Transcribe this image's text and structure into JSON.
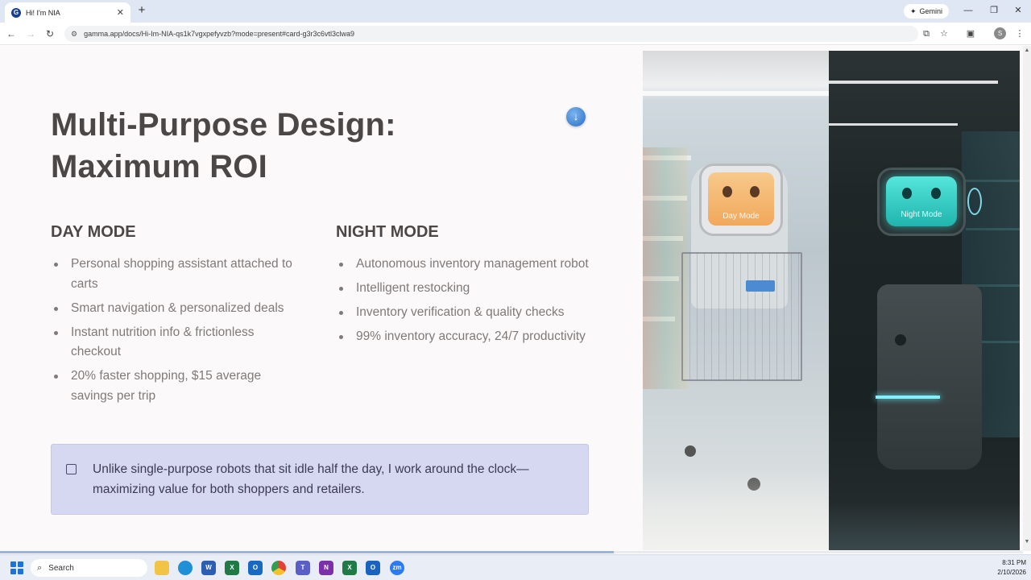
{
  "browser": {
    "tab_title": "Hi! I'm NIA",
    "tab_favicon": "G",
    "new_tab_icon": "+",
    "gemini_label": "Gemini",
    "url": "gamma.app/docs/Hi-Im-NIA-qs1k7vgxpefyvzb?mode=present#card-g3r3c6vtl3clwa9",
    "profile_initial": "S"
  },
  "slide": {
    "title_line1": "Multi-Purpose Design:",
    "title_line2": "Maximum ROI",
    "day": {
      "heading": "DAY MODE",
      "bullets": [
        "Personal shopping assistant attached to carts",
        "Smart navigation & personalized deals",
        "Instant nutrition info & frictionless checkout",
        "20% faster shopping, $15 average savings per trip"
      ]
    },
    "night": {
      "heading": "NIGHT MODE",
      "bullets": [
        "Autonomous inventory management robot",
        "Intelligent restocking",
        "Inventory verification & quality checks",
        "99% inventory accuracy, 24/7 productivity"
      ]
    },
    "callout": "Unlike single-purpose robots that sit idle half the day, I work around the clock—maximizing value for both shoppers and retailers.",
    "photo": {
      "day_screen_text": "Day Mode",
      "night_screen_text": "Night Mode"
    },
    "progress_fraction": 0.6
  },
  "taskbar": {
    "search_label": "Search",
    "time": "8:31 PM",
    "date": "2/10/2026",
    "apps": [
      "file-explorer",
      "edge",
      "word",
      "excel",
      "outlook",
      "chrome",
      "teams",
      "onenote",
      "excel-alt",
      "outlook-alt",
      "zoom"
    ],
    "zoom_label": "zm"
  },
  "colors": {
    "title": "#4a4746",
    "bullet_text": "#7d7a78",
    "callout_bg": "#d6d8f2",
    "night_screen": "#2ed6cf",
    "day_screen": "#f4b86a"
  }
}
